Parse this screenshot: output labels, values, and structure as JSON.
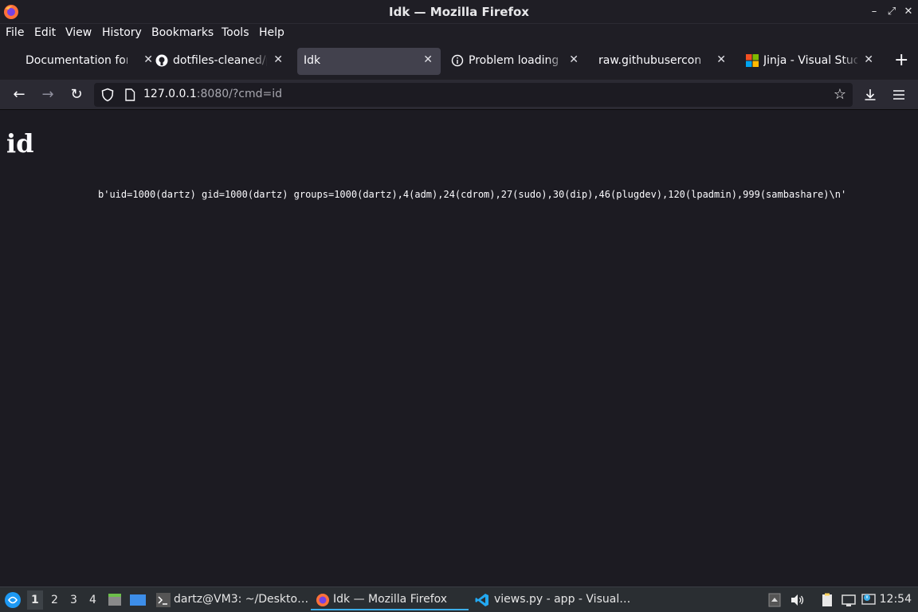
{
  "window": {
    "title": "Idk — Mozilla Firefox"
  },
  "menubar": {
    "items": [
      "File",
      "Edit",
      "View",
      "History",
      "Bookmarks",
      "Tools",
      "Help"
    ]
  },
  "tabs": [
    {
      "label": "Documentation for",
      "icon": "none",
      "active": false
    },
    {
      "label": "dotfiles-cleaned/py",
      "icon": "github-icon",
      "active": false
    },
    {
      "label": "Idk",
      "icon": "none",
      "active": true
    },
    {
      "label": "Problem loading pa",
      "icon": "info-icon",
      "active": false
    },
    {
      "label": "raw.githubusercontent",
      "icon": "none",
      "active": false
    },
    {
      "label": "Jinja - Visual Studio",
      "icon": "microsoft-icon",
      "active": false
    }
  ],
  "navbar": {
    "url_host": "127.0.0.1",
    "url_rest": ":8080/?cmd=id"
  },
  "page": {
    "heading": "id",
    "output": "b'uid=1000(dartz) gid=1000(dartz) groups=1000(dartz),4(adm),24(cdrom),27(sudo),30(dip),46(plugdev),120(lpadmin),999(sambashare)\\n'"
  },
  "taskbar": {
    "workspaces": [
      "1",
      "2",
      "3",
      "4"
    ],
    "active_workspace": "1",
    "tasks": [
      {
        "label": "dartz@VM3: ~/Deskto…",
        "icon": "terminal-icon",
        "active": false
      },
      {
        "label": "Idk — Mozilla Firefox",
        "icon": "firefox-icon",
        "active": true
      },
      {
        "label": "views.py - app - Visual…",
        "icon": "vscode-icon",
        "active": false
      }
    ],
    "clock": "12:54"
  },
  "colors": {
    "accent": "#3daee9",
    "page_bg": "#1c1b22",
    "active_tab": "#42414d"
  }
}
